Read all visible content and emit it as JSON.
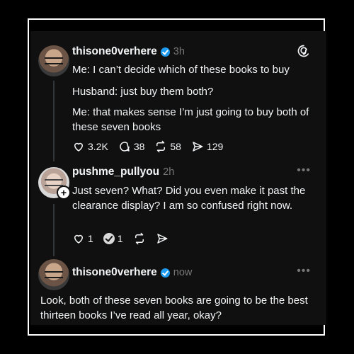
{
  "posts": [
    {
      "username": "thisone0verhere",
      "time": "3h",
      "lines": [
        "Me: I can’t decide which of these books to buy",
        "Husband: just buy them both?",
        "Me: that makes sense I’m just going to buy both of these seven books"
      ],
      "counts": {
        "likes": "3.2K",
        "replies": "38",
        "reposts": "58",
        "shares": "129"
      }
    },
    {
      "username": "pushme_pullyou",
      "time": "2h",
      "text": "Just seven? What? Did you even make it past the clearance display? I am so confused right now.",
      "counts": {
        "likes": "1",
        "replies": "1"
      }
    },
    {
      "username": "thisone0verhere",
      "time": "now",
      "text": "Look, both of these seven books are going to be the best thirteen books I’ve read all year, okay?"
    }
  ],
  "icons": {
    "verified": "verified-badge-icon",
    "logo": "threads-logo-icon",
    "more": "more-options-icon"
  },
  "colors": {
    "background": "#101010",
    "verified": "#1d9bf0",
    "muted": "#777777"
  }
}
